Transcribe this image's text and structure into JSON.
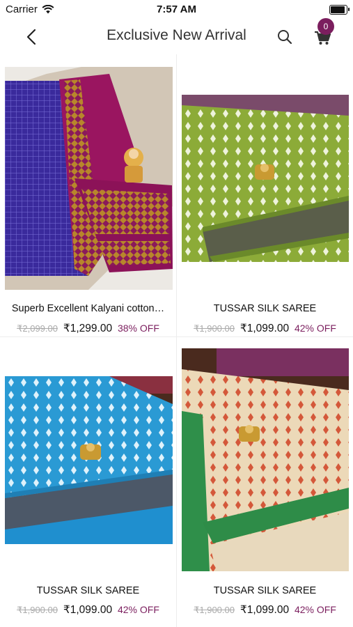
{
  "status_bar": {
    "carrier": "Carrier",
    "time": "7:57 AM",
    "battery_level": 0.95
  },
  "header": {
    "title": "Exclusive New Arrival",
    "cart_count": "0"
  },
  "products": [
    {
      "name": "Superb Excellent Kalyani cotton…",
      "mrp": "₹2,099.00",
      "price": "₹1,299.00",
      "discount": "38% OFF"
    },
    {
      "name": "TUSSAR SILK SAREE",
      "mrp": "₹1,900.00",
      "price": "₹1,099.00",
      "discount": "42% OFF"
    },
    {
      "name": "TUSSAR SILK SAREE",
      "mrp": "₹1,900.00",
      "price": "₹1,099.00",
      "discount": "42% OFF"
    },
    {
      "name": "TUSSAR SILK SAREE",
      "mrp": "₹1,900.00",
      "price": "₹1,099.00",
      "discount": "42% OFF"
    }
  ],
  "colors": {
    "accent": "#7b1e5e"
  }
}
